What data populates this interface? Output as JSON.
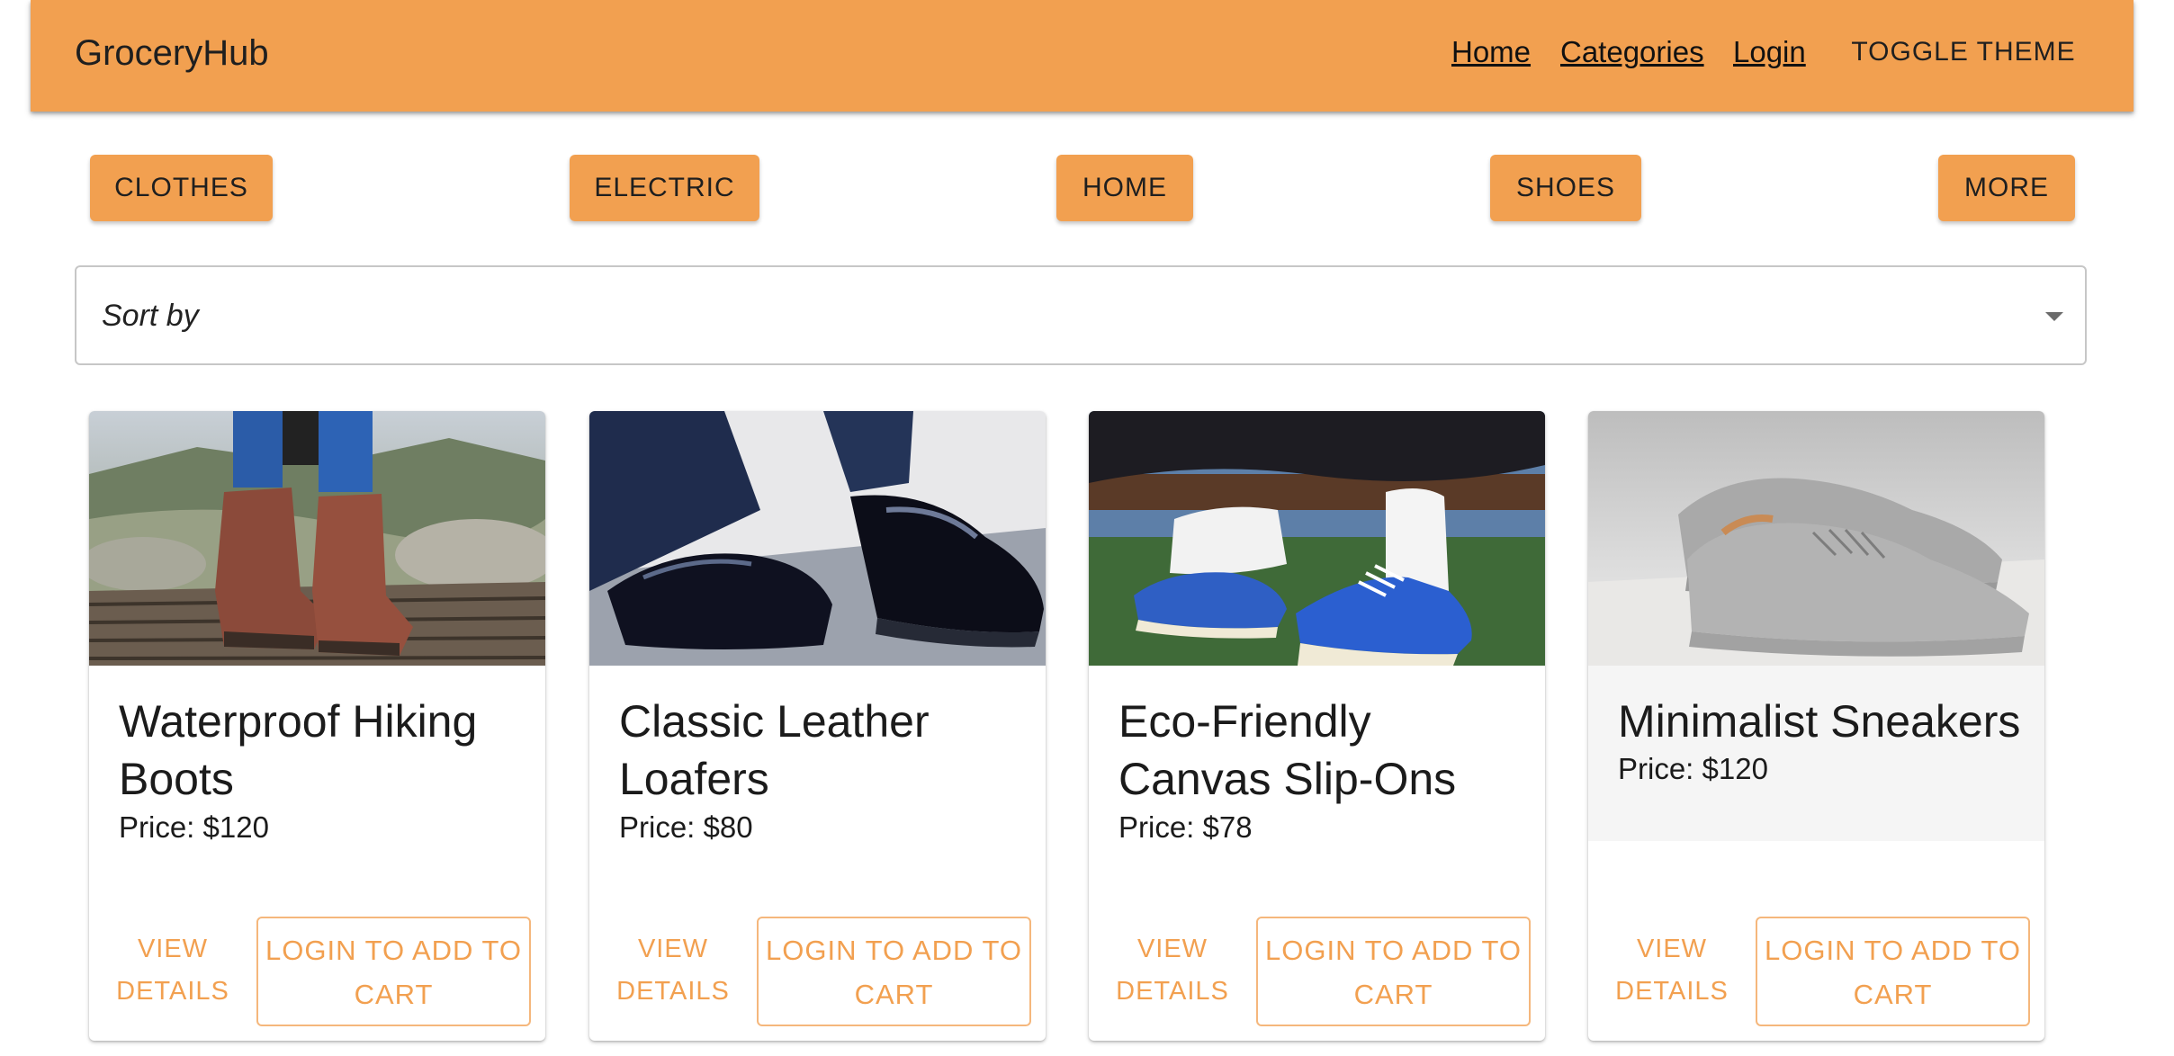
{
  "header": {
    "brand": "GroceryHub",
    "nav": [
      "Home",
      "Categories",
      "Login"
    ],
    "theme_toggle": "TOGGLE THEME",
    "accent_color": "#f2a050"
  },
  "categories": [
    "CLOTHES",
    "ELECTRIC",
    "HOME",
    "SHOES",
    "MORE"
  ],
  "sort": {
    "placeholder": "Sort by",
    "icon": "arrow-drop-down-icon"
  },
  "products": [
    {
      "name": "Waterproof Hiking Boots",
      "price": "Price: $120",
      "view_label": "VIEW DETAILS",
      "cart_label": "LOGIN TO ADD TO CART"
    },
    {
      "name": "Classic Leather Loafers",
      "price": "Price: $80",
      "view_label": "VIEW DETAILS",
      "cart_label": "LOGIN TO ADD TO CART"
    },
    {
      "name": "Eco-Friendly Canvas Slip-Ons",
      "price": "Price: $78",
      "view_label": "VIEW DETAILS",
      "cart_label": "LOGIN TO ADD TO CART"
    },
    {
      "name": "Minimalist Sneakers",
      "price": "Price: $120",
      "view_label": "VIEW DETAILS",
      "cart_label": "LOGIN TO ADD TO CART"
    }
  ]
}
